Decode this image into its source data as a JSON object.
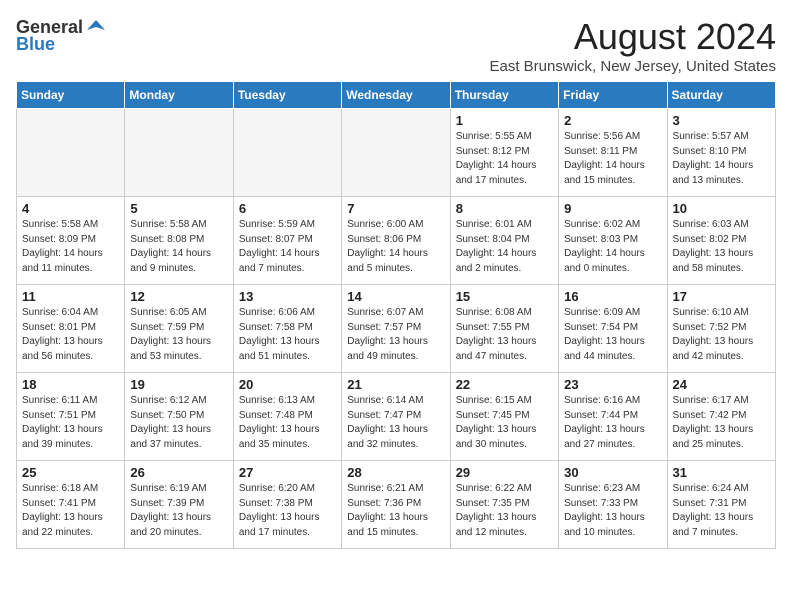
{
  "header": {
    "logo_general": "General",
    "logo_blue": "Blue",
    "month_year": "August 2024",
    "location": "East Brunswick, New Jersey, United States"
  },
  "weekdays": [
    "Sunday",
    "Monday",
    "Tuesday",
    "Wednesday",
    "Thursday",
    "Friday",
    "Saturday"
  ],
  "weeks": [
    [
      {
        "day": "",
        "empty": true
      },
      {
        "day": "",
        "empty": true
      },
      {
        "day": "",
        "empty": true
      },
      {
        "day": "",
        "empty": true
      },
      {
        "day": "1",
        "sunrise": "Sunrise: 5:55 AM",
        "sunset": "Sunset: 8:12 PM",
        "daylight": "Daylight: 14 hours and 17 minutes."
      },
      {
        "day": "2",
        "sunrise": "Sunrise: 5:56 AM",
        "sunset": "Sunset: 8:11 PM",
        "daylight": "Daylight: 14 hours and 15 minutes."
      },
      {
        "day": "3",
        "sunrise": "Sunrise: 5:57 AM",
        "sunset": "Sunset: 8:10 PM",
        "daylight": "Daylight: 14 hours and 13 minutes."
      }
    ],
    [
      {
        "day": "4",
        "sunrise": "Sunrise: 5:58 AM",
        "sunset": "Sunset: 8:09 PM",
        "daylight": "Daylight: 14 hours and 11 minutes."
      },
      {
        "day": "5",
        "sunrise": "Sunrise: 5:58 AM",
        "sunset": "Sunset: 8:08 PM",
        "daylight": "Daylight: 14 hours and 9 minutes."
      },
      {
        "day": "6",
        "sunrise": "Sunrise: 5:59 AM",
        "sunset": "Sunset: 8:07 PM",
        "daylight": "Daylight: 14 hours and 7 minutes."
      },
      {
        "day": "7",
        "sunrise": "Sunrise: 6:00 AM",
        "sunset": "Sunset: 8:06 PM",
        "daylight": "Daylight: 14 hours and 5 minutes."
      },
      {
        "day": "8",
        "sunrise": "Sunrise: 6:01 AM",
        "sunset": "Sunset: 8:04 PM",
        "daylight": "Daylight: 14 hours and 2 minutes."
      },
      {
        "day": "9",
        "sunrise": "Sunrise: 6:02 AM",
        "sunset": "Sunset: 8:03 PM",
        "daylight": "Daylight: 14 hours and 0 minutes."
      },
      {
        "day": "10",
        "sunrise": "Sunrise: 6:03 AM",
        "sunset": "Sunset: 8:02 PM",
        "daylight": "Daylight: 13 hours and 58 minutes."
      }
    ],
    [
      {
        "day": "11",
        "sunrise": "Sunrise: 6:04 AM",
        "sunset": "Sunset: 8:01 PM",
        "daylight": "Daylight: 13 hours and 56 minutes."
      },
      {
        "day": "12",
        "sunrise": "Sunrise: 6:05 AM",
        "sunset": "Sunset: 7:59 PM",
        "daylight": "Daylight: 13 hours and 53 minutes."
      },
      {
        "day": "13",
        "sunrise": "Sunrise: 6:06 AM",
        "sunset": "Sunset: 7:58 PM",
        "daylight": "Daylight: 13 hours and 51 minutes."
      },
      {
        "day": "14",
        "sunrise": "Sunrise: 6:07 AM",
        "sunset": "Sunset: 7:57 PM",
        "daylight": "Daylight: 13 hours and 49 minutes."
      },
      {
        "day": "15",
        "sunrise": "Sunrise: 6:08 AM",
        "sunset": "Sunset: 7:55 PM",
        "daylight": "Daylight: 13 hours and 47 minutes."
      },
      {
        "day": "16",
        "sunrise": "Sunrise: 6:09 AM",
        "sunset": "Sunset: 7:54 PM",
        "daylight": "Daylight: 13 hours and 44 minutes."
      },
      {
        "day": "17",
        "sunrise": "Sunrise: 6:10 AM",
        "sunset": "Sunset: 7:52 PM",
        "daylight": "Daylight: 13 hours and 42 minutes."
      }
    ],
    [
      {
        "day": "18",
        "sunrise": "Sunrise: 6:11 AM",
        "sunset": "Sunset: 7:51 PM",
        "daylight": "Daylight: 13 hours and 39 minutes."
      },
      {
        "day": "19",
        "sunrise": "Sunrise: 6:12 AM",
        "sunset": "Sunset: 7:50 PM",
        "daylight": "Daylight: 13 hours and 37 minutes."
      },
      {
        "day": "20",
        "sunrise": "Sunrise: 6:13 AM",
        "sunset": "Sunset: 7:48 PM",
        "daylight": "Daylight: 13 hours and 35 minutes."
      },
      {
        "day": "21",
        "sunrise": "Sunrise: 6:14 AM",
        "sunset": "Sunset: 7:47 PM",
        "daylight": "Daylight: 13 hours and 32 minutes."
      },
      {
        "day": "22",
        "sunrise": "Sunrise: 6:15 AM",
        "sunset": "Sunset: 7:45 PM",
        "daylight": "Daylight: 13 hours and 30 minutes."
      },
      {
        "day": "23",
        "sunrise": "Sunrise: 6:16 AM",
        "sunset": "Sunset: 7:44 PM",
        "daylight": "Daylight: 13 hours and 27 minutes."
      },
      {
        "day": "24",
        "sunrise": "Sunrise: 6:17 AM",
        "sunset": "Sunset: 7:42 PM",
        "daylight": "Daylight: 13 hours and 25 minutes."
      }
    ],
    [
      {
        "day": "25",
        "sunrise": "Sunrise: 6:18 AM",
        "sunset": "Sunset: 7:41 PM",
        "daylight": "Daylight: 13 hours and 22 minutes."
      },
      {
        "day": "26",
        "sunrise": "Sunrise: 6:19 AM",
        "sunset": "Sunset: 7:39 PM",
        "daylight": "Daylight: 13 hours and 20 minutes."
      },
      {
        "day": "27",
        "sunrise": "Sunrise: 6:20 AM",
        "sunset": "Sunset: 7:38 PM",
        "daylight": "Daylight: 13 hours and 17 minutes."
      },
      {
        "day": "28",
        "sunrise": "Sunrise: 6:21 AM",
        "sunset": "Sunset: 7:36 PM",
        "daylight": "Daylight: 13 hours and 15 minutes."
      },
      {
        "day": "29",
        "sunrise": "Sunrise: 6:22 AM",
        "sunset": "Sunset: 7:35 PM",
        "daylight": "Daylight: 13 hours and 12 minutes."
      },
      {
        "day": "30",
        "sunrise": "Sunrise: 6:23 AM",
        "sunset": "Sunset: 7:33 PM",
        "daylight": "Daylight: 13 hours and 10 minutes."
      },
      {
        "day": "31",
        "sunrise": "Sunrise: 6:24 AM",
        "sunset": "Sunset: 7:31 PM",
        "daylight": "Daylight: 13 hours and 7 minutes."
      }
    ]
  ]
}
